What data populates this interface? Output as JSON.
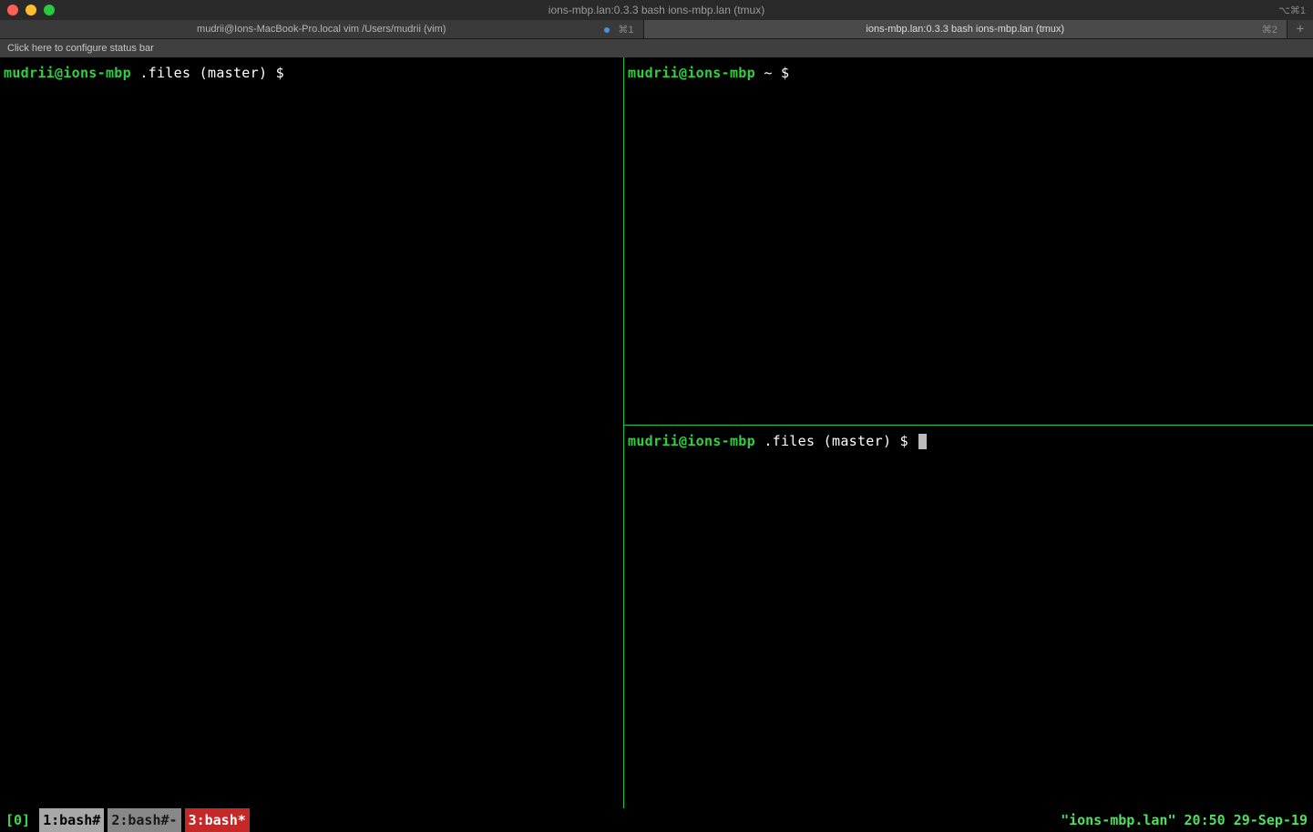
{
  "titlebar": {
    "window_title": "ions-mbp.lan:0.3.3 bash ions-mbp.lan (tmux)",
    "right_shortcut": "⌥⌘1"
  },
  "tabs": [
    {
      "label": "mudrii@Ions-MacBook-Pro.local vim /Users/mudrii (vim)",
      "shortcut": "⌘1",
      "has_indicator": true,
      "active": false
    },
    {
      "label": "ions-mbp.lan:0.3.3 bash ions-mbp.lan (tmux)",
      "shortcut": "⌘2",
      "has_indicator": false,
      "active": true
    }
  ],
  "statusbar_config": "Click here to configure status bar",
  "panes": {
    "left": {
      "user": "mudrii@ions-mbp",
      "path": ".files",
      "branch": "(master)",
      "symbol": "$"
    },
    "top_right": {
      "user": "mudrii@ions-mbp",
      "path": "~",
      "branch": "",
      "symbol": "$"
    },
    "bottom_right": {
      "user": "mudrii@ions-mbp",
      "path": ".files",
      "branch": "(master)",
      "symbol": "$"
    }
  },
  "tmux": {
    "session": "[0]",
    "windows": [
      {
        "label": "1:bash#"
      },
      {
        "label": "2:bash#-"
      },
      {
        "label": "3:bash*"
      }
    ],
    "status_right": "\"ions-mbp.lan\" 20:50 29-Sep-19"
  }
}
